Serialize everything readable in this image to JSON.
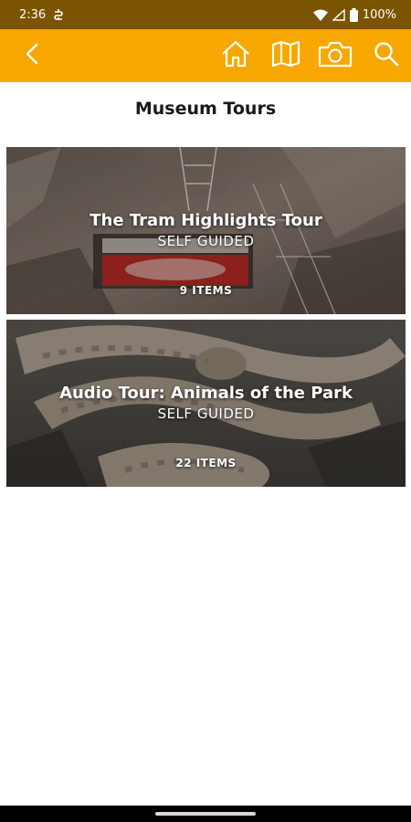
{
  "status_bar": {
    "time": "2:36",
    "battery": "100%",
    "icons": [
      "sync-icon",
      "wifi-icon",
      "signal-icon",
      "battery-icon"
    ]
  },
  "app_bar": {
    "background": "#f8a700",
    "icons": [
      "back-icon",
      "home-icon",
      "map-icon",
      "camera-icon",
      "search-icon"
    ]
  },
  "page": {
    "title": "Museum Tours"
  },
  "tours": [
    {
      "title": "The Tram Highlights Tour",
      "type": "SELF GUIDED",
      "count": "9 ITEMS",
      "image": "tram-photo"
    },
    {
      "title": "Audio Tour: Animals of the Park",
      "type": "SELF GUIDED",
      "count": "22 ITEMS",
      "image": "rattlesnake-photo"
    }
  ]
}
